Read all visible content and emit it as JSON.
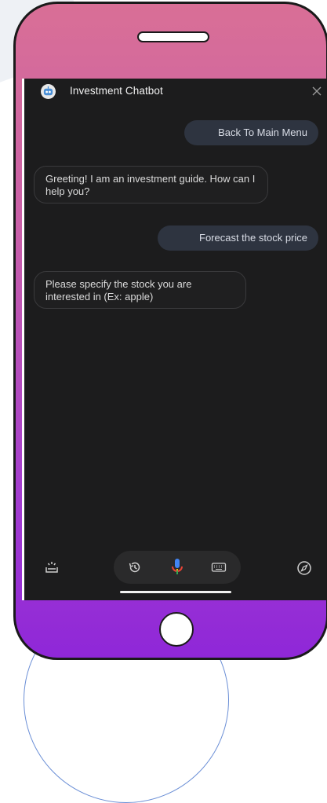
{
  "chat": {
    "title": "Investment Chatbot",
    "messages": [
      {
        "from": "user",
        "text": "Back To Main Menu"
      },
      {
        "from": "bot",
        "text": "Greeting!  I am an investment guide. How can I help you?"
      },
      {
        "from": "user",
        "text": "Forecast the stock price"
      },
      {
        "from": "bot",
        "text": "Please specify the stock you are interested in (Ex: apple)"
      }
    ]
  },
  "icons": {
    "avatar": "bot-avatar-icon",
    "close": "close-icon",
    "bottom_left": "assistant-snapshot-icon",
    "history": "history-icon",
    "mic": "microphone-icon",
    "keyboard": "keyboard-icon",
    "compass": "explore-compass-icon"
  },
  "colors": {
    "screen_bg": "#1c1c1d",
    "user_bubble": "#2e3440",
    "phone_gradient_top": "#d96f96",
    "phone_gradient_bottom": "#8f27d8"
  }
}
